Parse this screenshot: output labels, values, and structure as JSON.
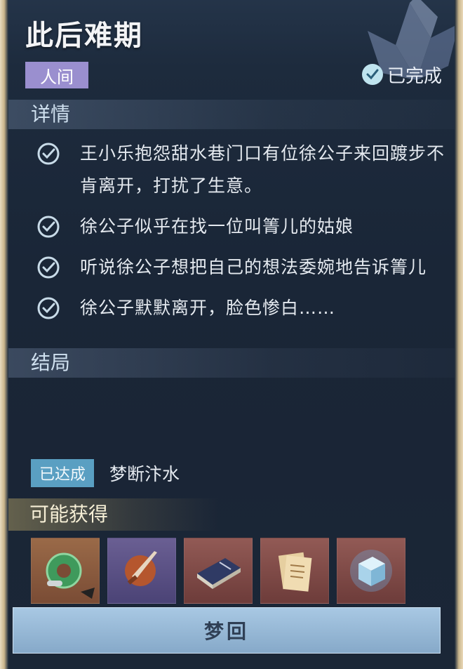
{
  "quest": {
    "title": "此后难期",
    "tag": "人间",
    "status": "已完成"
  },
  "details": {
    "heading": "详情",
    "items": [
      "王小乐抱怨甜水巷门口有位徐公子来回踱步不肯离开，打扰了生意。",
      "徐公子似乎在找一位叫箐儿的姑娘",
      "听说徐公子想把自己的想法委婉地告诉箐儿",
      "徐公子默默离开，脸色惨白……"
    ]
  },
  "ending": {
    "heading": "结局",
    "badge": "已达成",
    "name": "梦断汴水"
  },
  "rewards": {
    "heading": "可能获得",
    "items": [
      {
        "icon": "jade-pendant-icon",
        "rarity": "orange"
      },
      {
        "icon": "dagger-icon",
        "rarity": "purple"
      },
      {
        "icon": "book-icon",
        "rarity": "red"
      },
      {
        "icon": "scroll-paper-icon",
        "rarity": "red"
      },
      {
        "icon": "ice-cube-icon",
        "rarity": "red"
      }
    ]
  },
  "action": {
    "label": "梦回"
  }
}
